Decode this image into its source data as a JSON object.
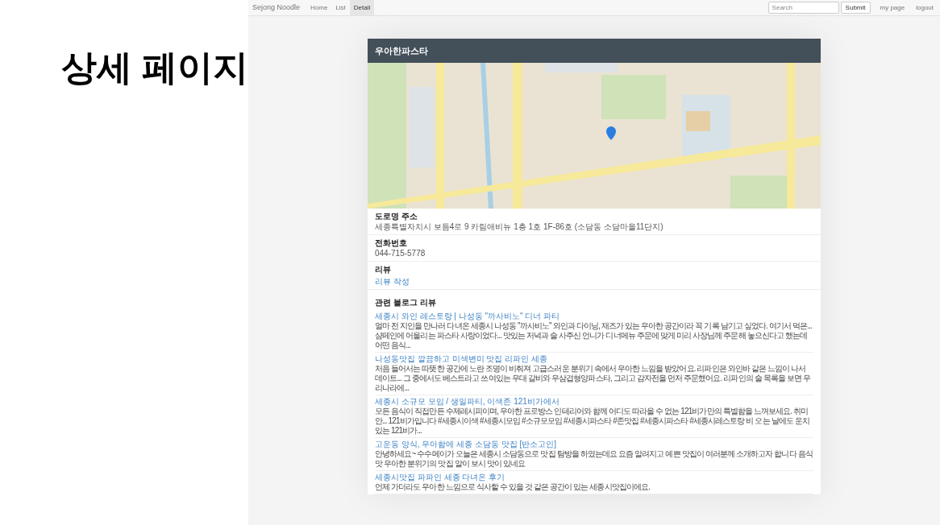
{
  "slide_title": "상세 페이지",
  "navbar": {
    "brand": "Sejong Noodle",
    "links": [
      {
        "label": "Home",
        "selected": false
      },
      {
        "label": "List",
        "selected": false
      },
      {
        "label": "Detail",
        "selected": true
      }
    ],
    "search": {
      "placeholder": "Search"
    },
    "submit": "Submit",
    "right_links": [
      "my page",
      "logout"
    ]
  },
  "restaurant": {
    "name": "우아한파스타",
    "sections": [
      {
        "title": "도로명 주소",
        "kind": "text",
        "value": "세종특별자치시 보듬4로 9 카림애비뉴 1층 1호 1F-86호 (소담동 소담마을11단지)"
      },
      {
        "title": "전화번호",
        "kind": "text",
        "value": "044-715-5778"
      },
      {
        "title": "리뷰",
        "kind": "link",
        "value": "리뷰 작성"
      }
    ],
    "blog_reviews": {
      "title": "관련 블로그 리뷰",
      "items": [
        {
          "title": "세종시 와인 레스토랑 | 나성동 \"까사비노\" 디너 파티",
          "summary": "얼마 전 지인을 만나러 다녀온 세종시 나성동 \"까사비노\" 와인과 다이닝, 재즈가 있는 우아한 공간이라 꼭 기록 남기고 싶었다. 여기서 먹은... 샴페인에 어울리는 파스타 사랑이었다... 맛있는 저녁과 술 사주신 언니가 디너메뉴 주문에 맞게 미리 사장님께 주문해 놓으신다고 했는데 어떤 음식..."
        },
        {
          "title": "나성동맛집 깔끔하고 미색변미 맛집 리파인 세종",
          "summary": "처음 들어서는 따뜻한 공간에 노란 조명이 비춰져 고급스러운 분위기 속에서 우아한 느낌을 받았어요. 리파인은 와인바 같은 느낌이 나서 데이트... 그 중에서도 베스트라고 쓰여있는 우대 갈비와 우삼겹형양파스타, 그리고 감자전을 먼저 주문했어요. 리파인의 술 목록을 보면 우리나라에..."
        },
        {
          "title": "세종시 소규모 모임 / 생일파티, 이색존 121비가에서",
          "summary": "모든 음식이 직접만든 수제레시피이며, 우아한 프로방스 인테리어와 함께 어디도 따라올 수 없는 121비가만의 특별함을 느껴보세요. 취미 안... 121비가입니다 #세종시이색 #세종시모임 #소규모모임 #세종시파스타 #존맛집 #세종시파스타 #세종시레스토랑 비 오는 날에도 운치있는 121비가..."
        },
        {
          "title": "고운동 양식, 우아함에 세종 소담동 맛집 [반소고인]",
          "summary": "안녕하세요~ 수수메이가 오늘은 세종시 소담동으로 맛집 탐방을 하였는데요 요즘 알려지고 예쁜 맛집이 여러분께 소개하고자 합니다 음식 맛 우아한 분위기의 맛집 알이 보시 맛이 있네요"
        },
        {
          "title": "세종시맛집 파파인 세종 다녀온 후기",
          "summary": "언제 가더라도 우아한 느낌으로 식사할 수 있을 것 같은 공간이 있는 세종시맛집이에요."
        }
      ]
    }
  }
}
